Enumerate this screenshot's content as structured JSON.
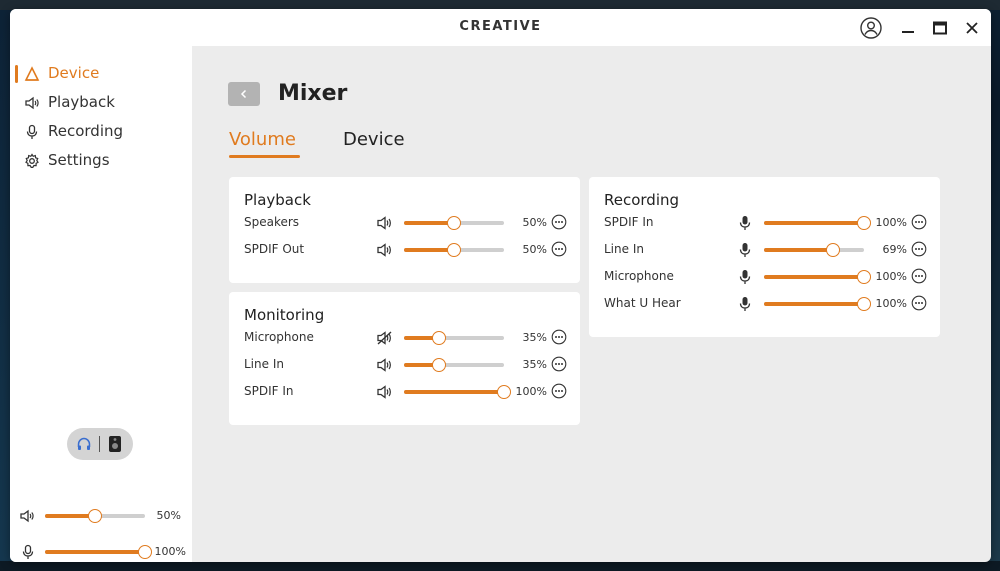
{
  "app": {
    "logo_text": "CREATIVE"
  },
  "colors": {
    "accent": "#e07b1f",
    "track": "#cfcfcf"
  },
  "sidebar": {
    "items": [
      {
        "label": "Device",
        "icon": "device-icon",
        "active": true
      },
      {
        "label": "Playback",
        "icon": "speaker-icon",
        "active": false
      },
      {
        "label": "Recording",
        "icon": "microphone-icon",
        "active": false
      },
      {
        "label": "Settings",
        "icon": "gear-icon",
        "active": false
      }
    ],
    "output_toggle": {
      "left_icon": "headphones-icon",
      "right_icon": "speaker-box-icon"
    },
    "master_volume": {
      "value": 50,
      "label": "50%"
    },
    "master_mic": {
      "value": 100,
      "label": "100%"
    }
  },
  "page": {
    "title": "Mixer",
    "tabs": [
      {
        "label": "Volume",
        "active": true
      },
      {
        "label": "Device",
        "active": false
      }
    ]
  },
  "cards": {
    "playback": {
      "title": "Playback",
      "channels": [
        {
          "name": "Speakers",
          "icon": "speaker-icon",
          "value": 50,
          "label": "50%"
        },
        {
          "name": "SPDIF Out",
          "icon": "speaker-icon",
          "value": 50,
          "label": "50%"
        }
      ]
    },
    "monitoring": {
      "title": "Monitoring",
      "channels": [
        {
          "name": "Microphone",
          "icon": "speaker-muted-icon",
          "value": 35,
          "label": "35%"
        },
        {
          "name": "Line In",
          "icon": "speaker-icon",
          "value": 35,
          "label": "35%"
        },
        {
          "name": "SPDIF In",
          "icon": "speaker-icon",
          "value": 100,
          "label": "100%"
        }
      ]
    },
    "recording": {
      "title": "Recording",
      "channels": [
        {
          "name": "SPDIF In",
          "icon": "microphone-icon",
          "value": 100,
          "label": "100%"
        },
        {
          "name": "Line In",
          "icon": "microphone-icon",
          "value": 69,
          "label": "69%"
        },
        {
          "name": "Microphone",
          "icon": "microphone-icon",
          "value": 100,
          "label": "100%"
        },
        {
          "name": "What U Hear",
          "icon": "microphone-icon",
          "value": 100,
          "label": "100%"
        }
      ]
    }
  }
}
